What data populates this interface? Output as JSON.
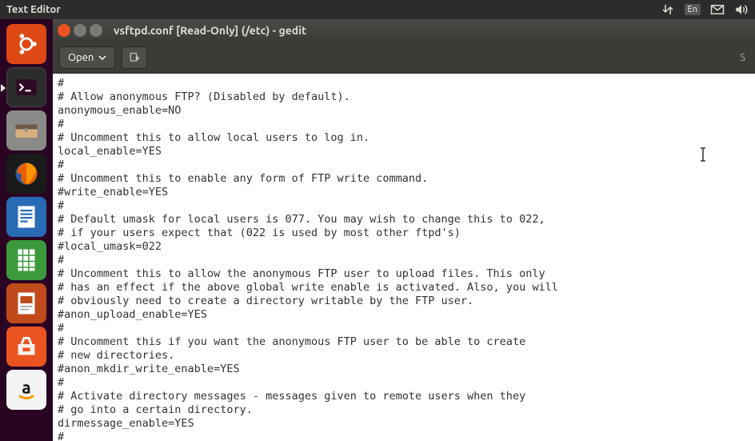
{
  "top_panel": {
    "app_title": "Text Editor",
    "language": "En"
  },
  "launcher": {
    "items": [
      {
        "name": "ubuntu-dash",
        "bg": "#dd4814"
      },
      {
        "name": "terminal",
        "bg": "#2c2c2c"
      },
      {
        "name": "files",
        "bg": "#8a8a88"
      },
      {
        "name": "firefox",
        "bg": "#1a1a1a"
      },
      {
        "name": "libreoffice-writer",
        "bg": "#2a6bb6"
      },
      {
        "name": "libreoffice-calc",
        "bg": "#3c9a3c"
      },
      {
        "name": "libreoffice-impress",
        "bg": "#c14a1a"
      },
      {
        "name": "software-center",
        "bg": "#e95420"
      },
      {
        "name": "amazon",
        "bg": "#f4f4f4"
      }
    ]
  },
  "window": {
    "title": "vsftpd.conf [Read-Only] (/etc) - gedit"
  },
  "toolbar": {
    "open_label": "Open",
    "save_hint": "S"
  },
  "editor": {
    "content": "#\n# Allow anonymous FTP? (Disabled by default).\nanonymous_enable=NO\n#\n# Uncomment this to allow local users to log in.\nlocal_enable=YES\n#\n# Uncomment this to enable any form of FTP write command.\n#write_enable=YES\n#\n# Default umask for local users is 077. You may wish to change this to 022,\n# if your users expect that (022 is used by most other ftpd's)\n#local_umask=022\n#\n# Uncomment this to allow the anonymous FTP user to upload files. This only\n# has an effect if the above global write enable is activated. Also, you will\n# obviously need to create a directory writable by the FTP user.\n#anon_upload_enable=YES\n#\n# Uncomment this if you want the anonymous FTP user to be able to create\n# new directories.\n#anon_mkdir_write_enable=YES\n#\n# Activate directory messages - messages given to remote users when they\n# go into a certain directory.\ndirmessage_enable=YES\n#"
  }
}
